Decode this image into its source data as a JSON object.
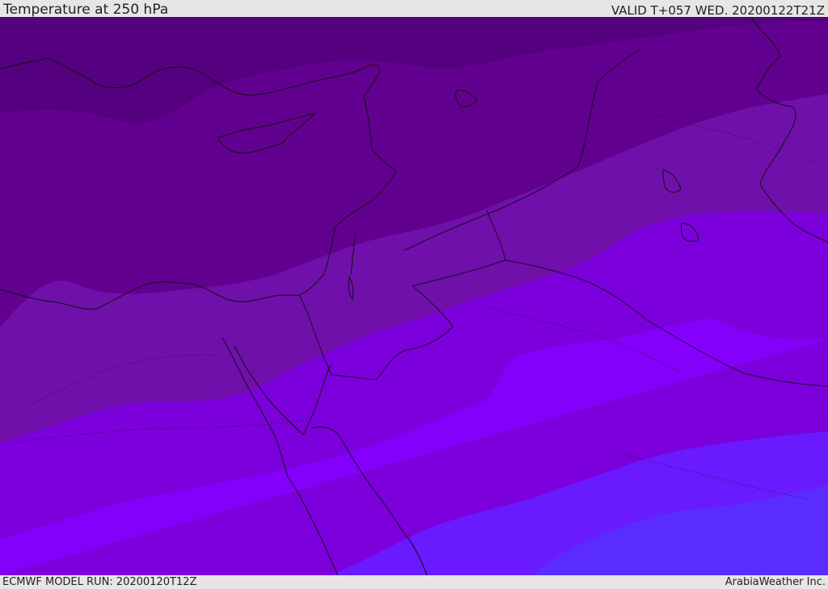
{
  "header": {
    "title": "Temperature at 250 hPa",
    "valid": "VALID T+057 WED. 20200122T21Z"
  },
  "footer": {
    "model_run": "ECMWF MODEL RUN: 20200120T12Z",
    "credit": "ArabiaWeather Inc."
  },
  "map": {
    "colors": {
      "band_coldest": "#54007f",
      "band_2": "#62008f",
      "band_3": "#7010ab",
      "band_4": "#7c00dc",
      "band_5": "#8500fb",
      "band_6": "#6a1aff",
      "band_warmest": "#5a2cff",
      "coastline": "#111111",
      "border": "#1a0a2a"
    }
  }
}
